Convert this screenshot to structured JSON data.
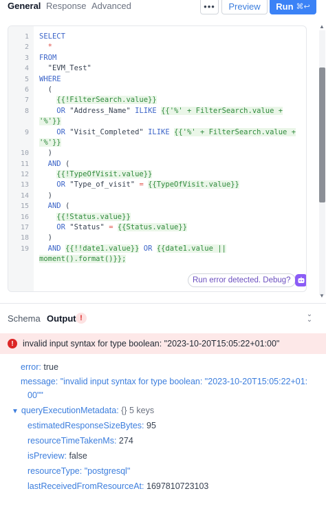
{
  "tabs": {
    "general": "General",
    "response": "Response",
    "advanced": "Advanced"
  },
  "toolbar": {
    "more": "•••",
    "preview": "Preview",
    "run": "Run",
    "run_shortcut": "⌘↩"
  },
  "editor": {
    "lines": [
      {
        "n": "1"
      },
      {
        "n": "2"
      },
      {
        "n": "3"
      },
      {
        "n": "4"
      },
      {
        "n": "5"
      },
      {
        "n": "6"
      },
      {
        "n": "7"
      },
      {
        "n": "8"
      },
      {
        "n": ""
      },
      {
        "n": "9"
      },
      {
        "n": ""
      },
      {
        "n": "10"
      },
      {
        "n": "11"
      },
      {
        "n": "12"
      },
      {
        "n": "13"
      },
      {
        "n": "14"
      },
      {
        "n": "15"
      },
      {
        "n": "16"
      },
      {
        "n": "17"
      },
      {
        "n": "18"
      },
      {
        "n": "19"
      },
      {
        "n": ""
      }
    ],
    "tokens": {
      "select": "SELECT",
      "star": "*",
      "from": "FROM",
      "table": "\"EVM_Test\"",
      "where": "WHERE",
      "paren_open": "(",
      "filter_check": "{{!FilterSearch.value}}",
      "or": "OR",
      "address_col": "\"Address_Name\"",
      "ilike": "ILIKE",
      "ilike_tpl": "{{'%' + FilterSearch.value +",
      "ilike_tpl_end": "'%'}}",
      "visit_col": "\"Visit_Completed\"",
      "paren_close": ")",
      "and": "AND",
      "type_check": "{{!TypeOfVisit.value}}",
      "type_col": "\"Type_of_visit\"",
      "eq": "=",
      "type_tpl": "{{TypeOfVisit.value}}",
      "status_check": "{{!Status.value}}",
      "status_col": "\"Status\"",
      "status_tpl": "{{Status.value}}",
      "date_check": "{{!!date1.value}}",
      "date_tpl": "{{date1.value ||",
      "date_tpl_end": "moment().format()}};"
    },
    "debug_label": "Run error detected. Debug?"
  },
  "output": {
    "schema_tab": "Schema",
    "output_tab": "Output",
    "warn_symbol": "!",
    "error_banner": "invalid input syntax for type boolean: \"2023-10-20T15:05:22+01:00\"",
    "error_key": "error:",
    "error_value": "true",
    "message_key": "message:",
    "message_value_1": "\"invalid input syntax for type boolean: \"2023-10-20T15:05:22+01:",
    "message_value_2": "00\"\"",
    "meta_key": "queryExecutionMetadata:",
    "meta_type": "{}",
    "meta_count": "5 keys",
    "fields": [
      {
        "key": "estimatedResponseSizeBytes:",
        "value": "95",
        "kind": "plain"
      },
      {
        "key": "resourceTimeTakenMs:",
        "value": "274",
        "kind": "plain"
      },
      {
        "key": "isPreview:",
        "value": "false",
        "kind": "plain"
      },
      {
        "key": "resourceType:",
        "value": "\"postgresql\"",
        "kind": "str"
      },
      {
        "key": "lastReceivedFromResourceAt:",
        "value": "1697810723103",
        "kind": "plain"
      }
    ]
  },
  "colors": {
    "accent": "#3b82f6",
    "error_bg": "#fde8e8",
    "error": "#dc2626",
    "debug": "#8b5cf6"
  }
}
